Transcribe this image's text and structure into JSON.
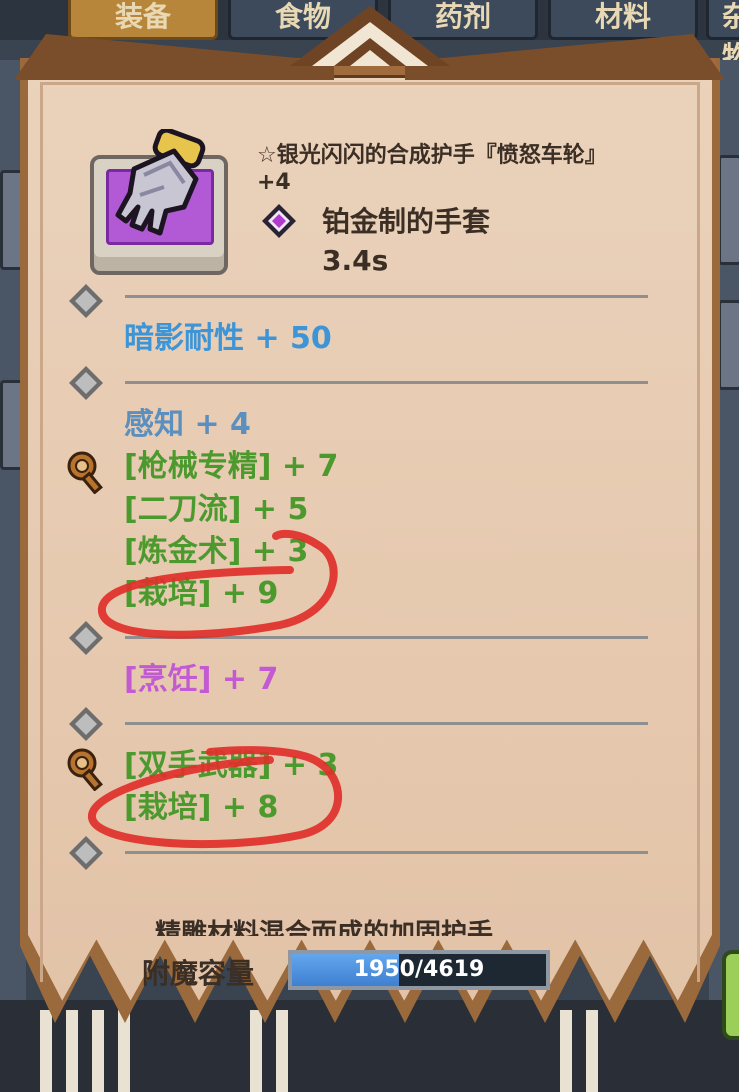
{
  "background": {
    "tabs": [
      "装备",
      "食物",
      "药剂",
      "材料",
      "杂物"
    ]
  },
  "item": {
    "name": "☆银光闪闪的合成护手『愤怒车轮』",
    "plus": "+4",
    "type": "铂金制的手套",
    "speed": "3.4s",
    "rarity_color": "#b25ad6"
  },
  "stat_groups": [
    {
      "lines": [
        {
          "text": "暗影耐性 + 50",
          "color": "blue"
        }
      ]
    },
    {
      "lines": [
        {
          "text": "感知 + 4",
          "color": "lightblue"
        },
        {
          "text": "[枪械专精] + 7",
          "color": "green"
        },
        {
          "text": "[二刀流] + 5",
          "color": "green"
        },
        {
          "text": "[炼金术] + 3",
          "color": "green"
        },
        {
          "text": "[栽培] + 9",
          "color": "green"
        }
      ]
    },
    {
      "lines": [
        {
          "text": "[烹饪] + 7",
          "color": "pink"
        }
      ]
    },
    {
      "lines": [
        {
          "text": "[双手武器] + 3",
          "color": "green"
        },
        {
          "text": "[栽培] + 8",
          "color": "green"
        }
      ]
    }
  ],
  "description": "精雕材料混合而成的加固护手",
  "enchant": {
    "label": "附魔容量",
    "current": 1950,
    "max": 4619,
    "text": "1950/4619",
    "fill_fraction": 0.422
  },
  "colors": {
    "panel": "#e8cfb7",
    "frame": "#9a6a3c",
    "blue": "#3d94d6",
    "green": "#4c9a2e",
    "pink": "#c25bd1",
    "annotation": "#e0302a"
  }
}
